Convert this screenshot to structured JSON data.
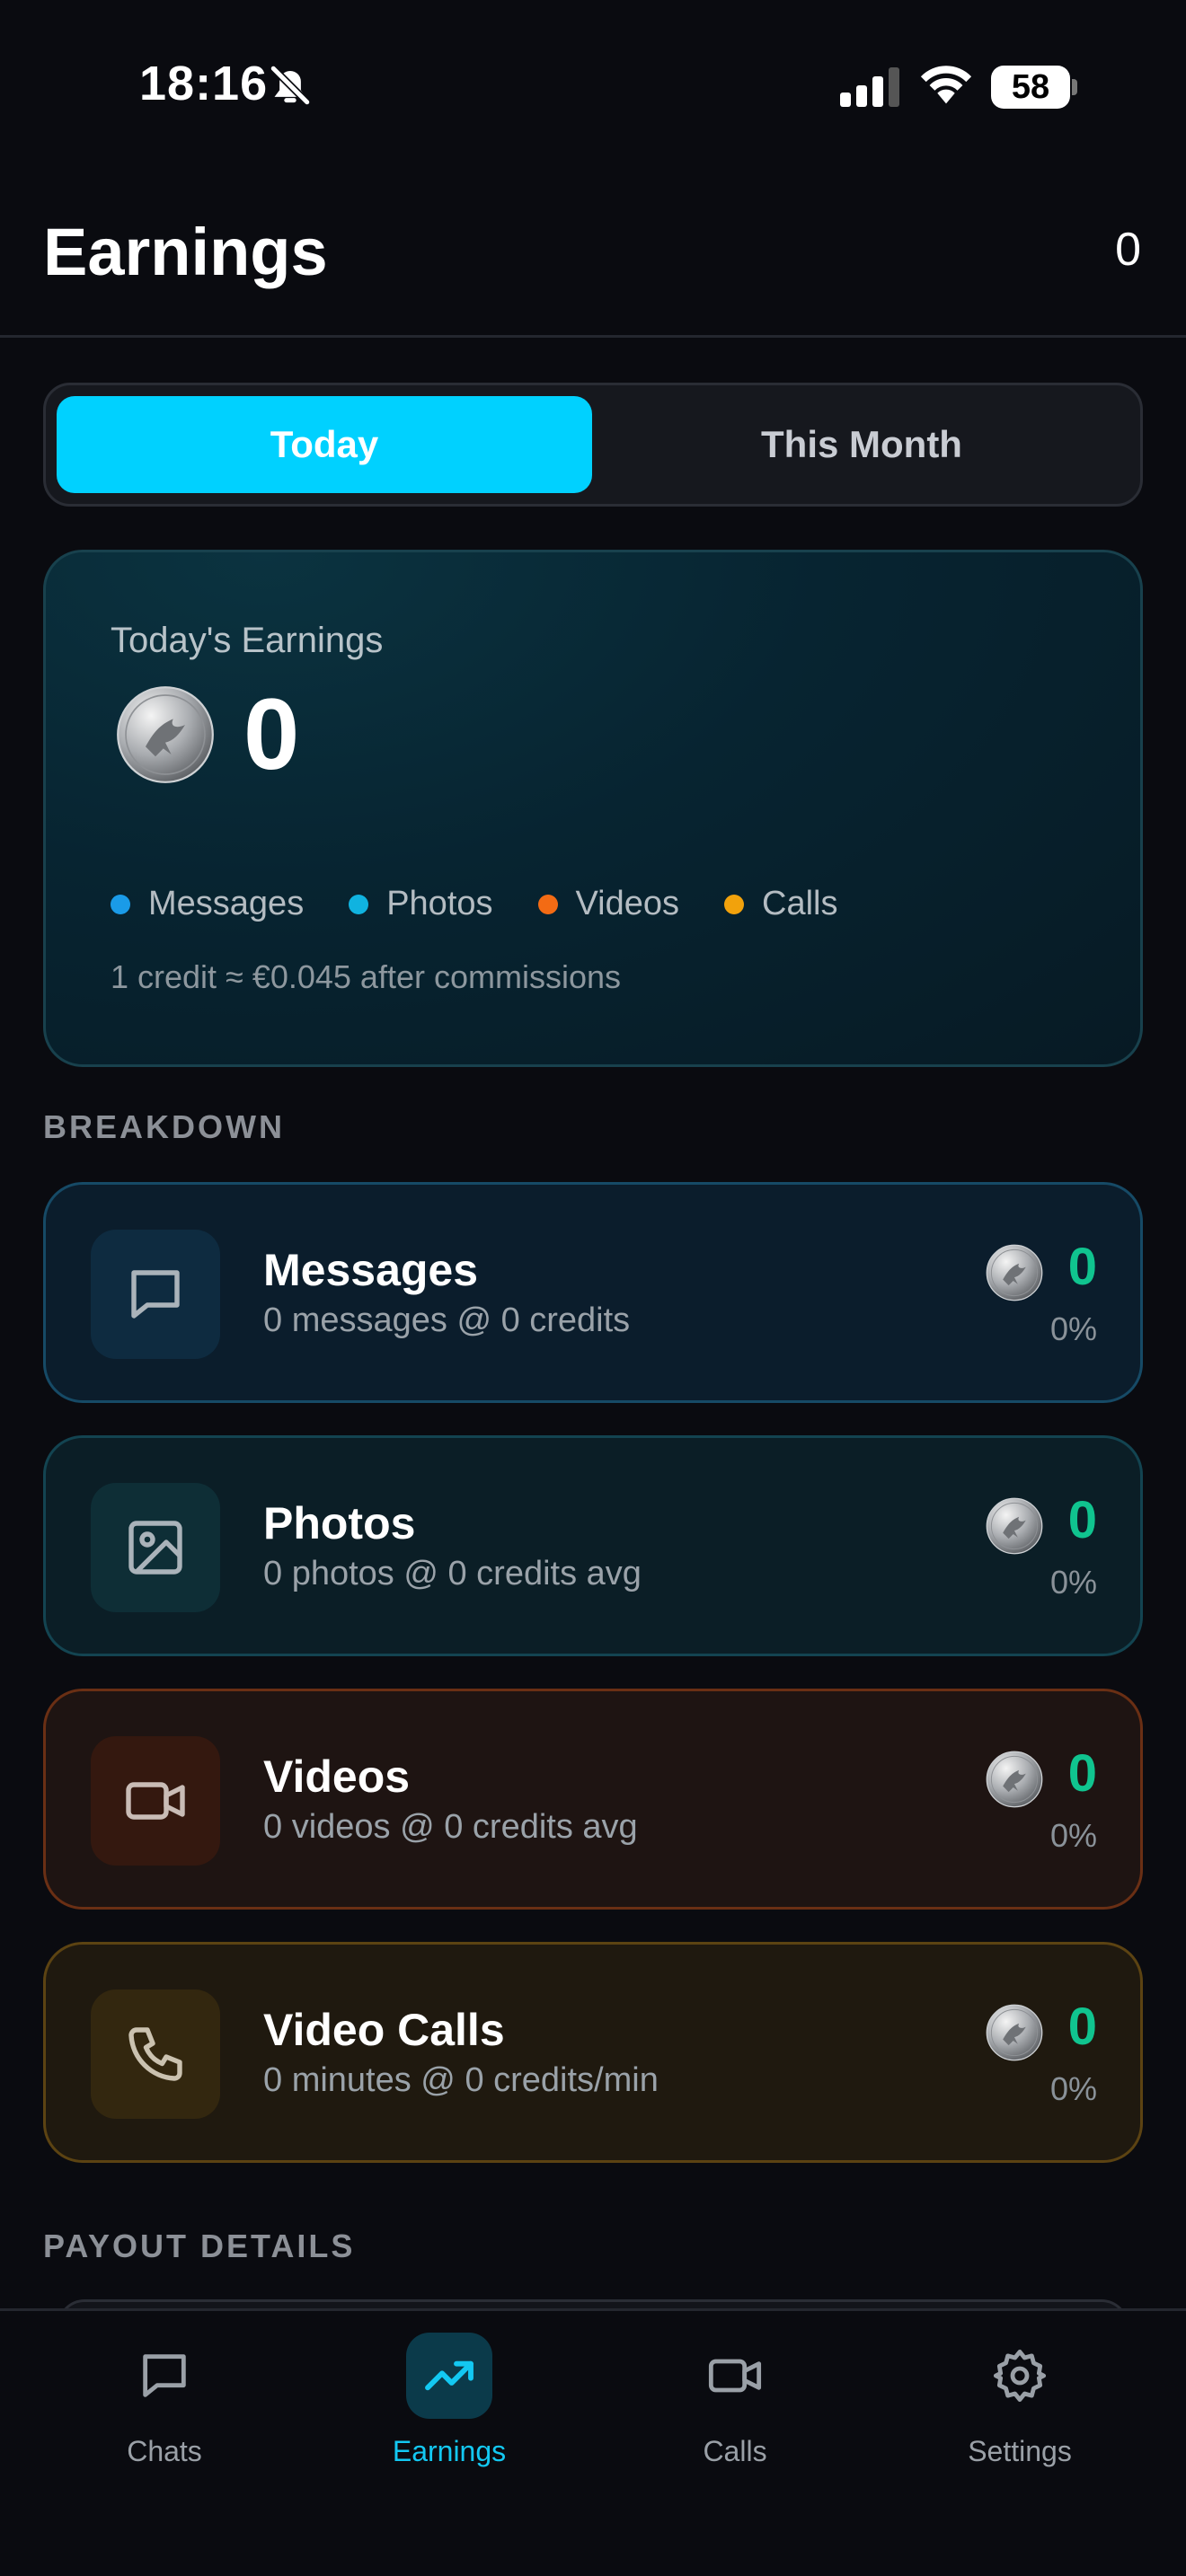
{
  "status_bar": {
    "time": "18:16",
    "battery": "58"
  },
  "header": {
    "title": "Earnings",
    "count": "0"
  },
  "segmented": {
    "today": "Today",
    "month": "This Month"
  },
  "earnings_card": {
    "label": "Today's Earnings",
    "value": "0",
    "legend": [
      {
        "label": "Messages",
        "color": "#1a9be8"
      },
      {
        "label": "Photos",
        "color": "#10b3e0"
      },
      {
        "label": "Videos",
        "color": "#f36b14"
      },
      {
        "label": "Calls",
        "color": "#f2a20c"
      }
    ],
    "rate": "1 credit ≈ €0.045 after commissions"
  },
  "breakdown": {
    "label": "BREAKDOWN",
    "items": [
      {
        "title": "Messages",
        "subtitle": "0 messages @ 0 credits",
        "value": "0",
        "percent": "0%",
        "icon": "chat-bubble-icon",
        "bg": "#0b1d2c",
        "border": "#164a66",
        "icon_bg": "#0e2b40"
      },
      {
        "title": "Photos",
        "subtitle": "0 photos @ 0 credits avg",
        "value": "0",
        "percent": "0%",
        "icon": "image-icon",
        "bg": "#0b1e26",
        "border": "#134451",
        "icon_bg": "#0e2e36"
      },
      {
        "title": "Videos",
        "subtitle": "0 videos @ 0 credits avg",
        "value": "0",
        "percent": "0%",
        "icon": "video-camera-icon",
        "bg": "#1e1412",
        "border": "#6a2f14",
        "icon_bg": "#34180f"
      },
      {
        "title": "Video Calls",
        "subtitle": "0 minutes @ 0 credits/min",
        "value": "0",
        "percent": "0%",
        "icon": "phone-icon",
        "bg": "#1f190f",
        "border": "#5c4312",
        "icon_bg": "#33270f"
      }
    ]
  },
  "payout": {
    "label": "PAYOUT DETAILS"
  },
  "tabs": [
    {
      "label": "Chats",
      "icon": "chat-bubble-icon"
    },
    {
      "label": "Earnings",
      "icon": "trending-up-icon"
    },
    {
      "label": "Calls",
      "icon": "video-camera-icon"
    },
    {
      "label": "Settings",
      "icon": "gear-icon"
    }
  ],
  "colors": {
    "accent": "#00d1ff",
    "positive": "#10c48f"
  }
}
